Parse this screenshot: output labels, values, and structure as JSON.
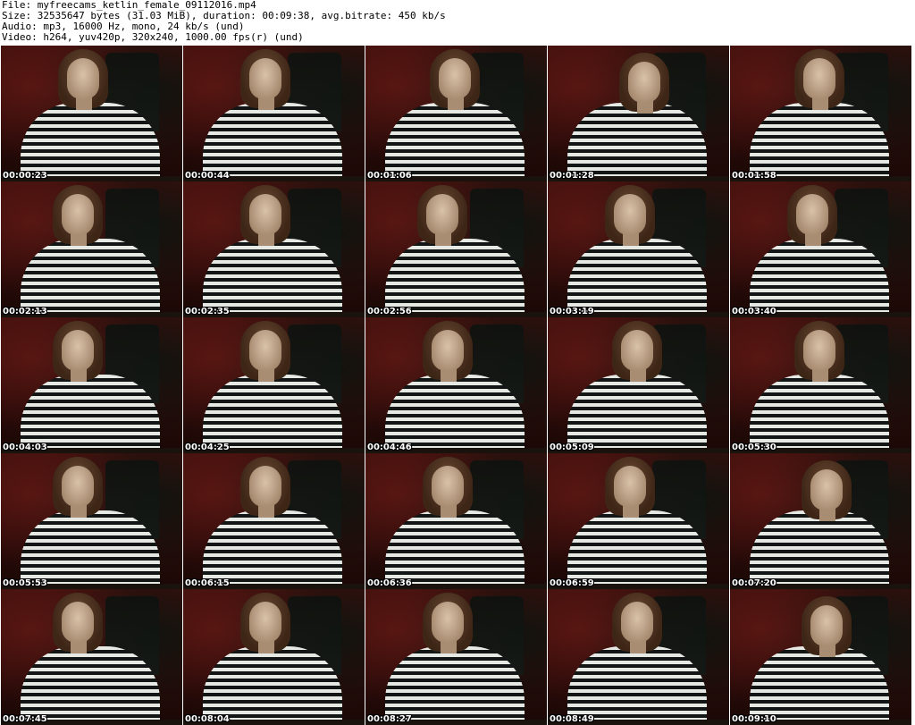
{
  "header": {
    "file_line": "File: myfreecams_ketlin_female_09112016.mp4",
    "size_line": "Size: 32535647 bytes (31.03 MiB), duration: 00:09:38, avg.bitrate: 450 kb/s",
    "audio_line": "Audio: mp3, 16000 Hz, mono, 24 kb/s (und)",
    "video_line": "Video: h264, yuv420p, 320x240, 1000.00 fps(r) (und)"
  },
  "thumbnails": [
    {
      "timestamp": "00:00:23"
    },
    {
      "timestamp": "00:00:44"
    },
    {
      "timestamp": "00:01:06"
    },
    {
      "timestamp": "00:01:28"
    },
    {
      "timestamp": "00:01:58"
    },
    {
      "timestamp": "00:02:13"
    },
    {
      "timestamp": "00:02:35"
    },
    {
      "timestamp": "00:02:56"
    },
    {
      "timestamp": "00:03:19"
    },
    {
      "timestamp": "00:03:40"
    },
    {
      "timestamp": "00:04:03"
    },
    {
      "timestamp": "00:04:25"
    },
    {
      "timestamp": "00:04:46"
    },
    {
      "timestamp": "00:05:09"
    },
    {
      "timestamp": "00:05:30"
    },
    {
      "timestamp": "00:05:53"
    },
    {
      "timestamp": "00:06:15"
    },
    {
      "timestamp": "00:06:36"
    },
    {
      "timestamp": "00:06:59"
    },
    {
      "timestamp": "00:07:20"
    },
    {
      "timestamp": "00:07:45"
    },
    {
      "timestamp": "00:08:04"
    },
    {
      "timestamp": "00:08:27"
    },
    {
      "timestamp": "00:08:49"
    },
    {
      "timestamp": "00:09:10"
    }
  ]
}
